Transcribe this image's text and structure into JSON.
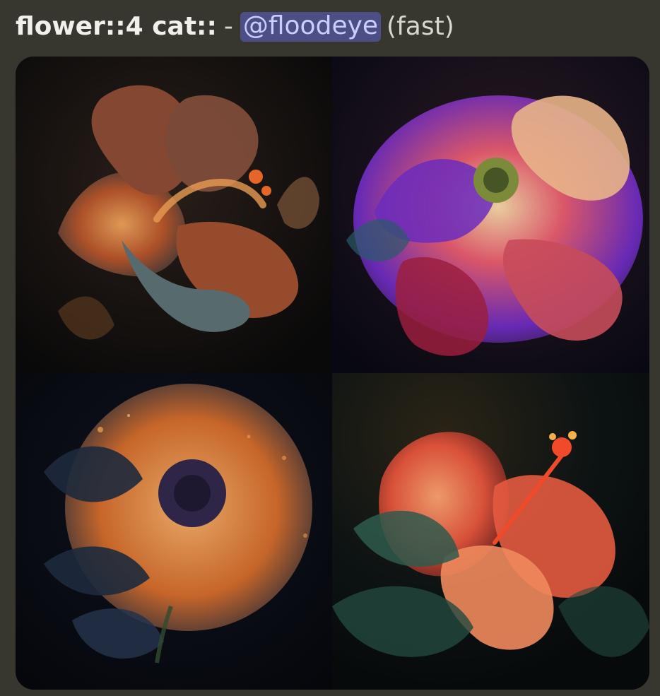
{
  "message": {
    "prompt": "flower::4 cat::",
    "separator": "-",
    "mention": "@floodeye",
    "mode": "(fast)"
  },
  "images": [
    {
      "name": "flower-image-1",
      "palette": [
        "#1a1411",
        "#c2612b",
        "#e8a05a",
        "#4f6d73"
      ]
    },
    {
      "name": "flower-image-2",
      "palette": [
        "#0f0e16",
        "#7a2bd0",
        "#e35a6c",
        "#f1c38d"
      ]
    },
    {
      "name": "flower-image-3",
      "palette": [
        "#07080c",
        "#e59a4b",
        "#1d2a3c",
        "#3a2e5a"
      ]
    },
    {
      "name": "flower-image-4",
      "palette": [
        "#0d1313",
        "#e2533b",
        "#f08a5d",
        "#2f5a4c"
      ]
    }
  ]
}
